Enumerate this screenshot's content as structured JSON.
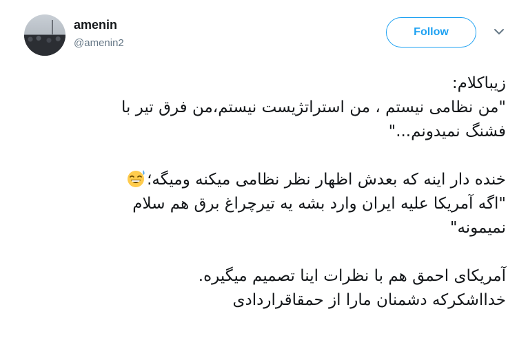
{
  "user": {
    "display_name": "amenin",
    "handle": "@amenin2"
  },
  "follow_button": {
    "label": "Follow"
  },
  "tweet": {
    "lines_block1": [
      "زیباکلام:",
      "\"من نظامی نیستم ، من استراتژیست نیستم،من فرق تیر با",
      "فشنگ نمیدونم...\""
    ],
    "line_emoji": "خنده دار اینه که بعدش اظهار نظر نظامی میکنه ومیگه؛",
    "lines_block2": [
      "\"اگه آمریکا علیه ایران وارد بشه یه تیرچراغ برق هم سلام",
      "نمیمونه\""
    ],
    "lines_block3": [
      "آمریکای احمق هم با نظرات اینا تصمیم میگیره.",
      "خدااشکرکه دشمنان مارا از حمقاقراردادی"
    ],
    "emoji": "grinning-face-with-sweat"
  },
  "colors": {
    "accent": "#1da1f2",
    "text": "#14171a",
    "secondary": "#657786"
  }
}
